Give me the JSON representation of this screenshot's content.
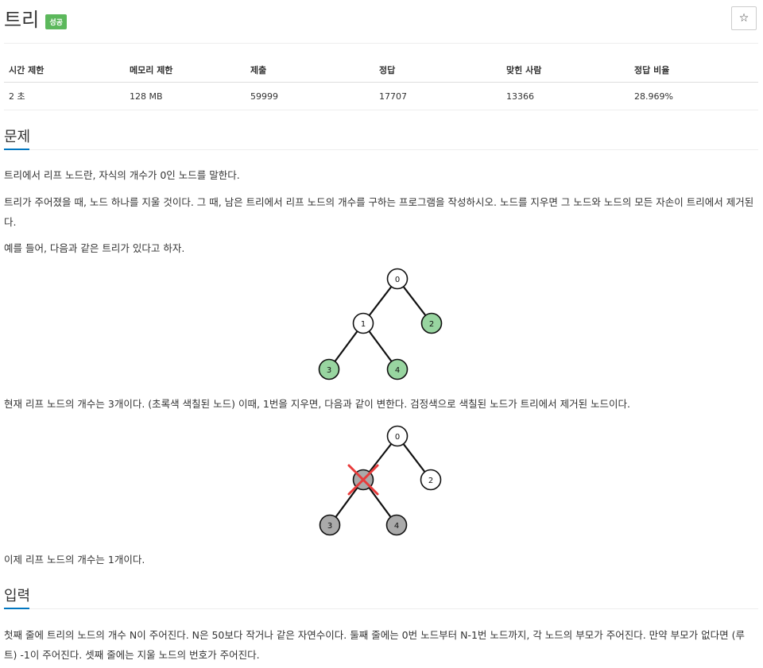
{
  "header": {
    "title": "트리",
    "status_badge": "성공",
    "star_icon": "☆"
  },
  "stats": {
    "headers": [
      "시간 제한",
      "메모리 제한",
      "제출",
      "정답",
      "맞힌 사람",
      "정답 비율"
    ],
    "values": [
      "2 초",
      "128 MB",
      "59999",
      "17707",
      "13366",
      "28.969%"
    ]
  },
  "problem": {
    "heading": "문제",
    "p1": "트리에서 리프 노드란, 자식의 개수가 0인 노드를 말한다.",
    "p2": "트리가 주어졌을 때, 노드 하나를 지울 것이다. 그 때, 남은 트리에서 리프 노드의 개수를 구하는 프로그램을 작성하시오. 노드를 지우면 그 노드와 노드의 모든 자손이 트리에서 제거된다.",
    "p3": "예를 들어, 다음과 같은 트리가 있다고 하자.",
    "p4": "현재 리프 노드의 개수는 3개이다. (초록색 색칠된 노드) 이때, 1번을 지우면, 다음과 같이 변한다. 검정색으로 색칠된 노드가 트리에서 제거된 노드이다.",
    "p5": "이제 리프 노드의 개수는 1개이다."
  },
  "tree1": {
    "nodes": [
      "0",
      "1",
      "2",
      "3",
      "4"
    ],
    "colors": {
      "leaf": "#98d5a0",
      "normal": "#ffffff"
    }
  },
  "tree2": {
    "nodes": [
      "0",
      "1",
      "2",
      "3",
      "4"
    ],
    "colors": {
      "removed": "#aaaaaa",
      "normal": "#ffffff",
      "cross": "#e83b3b"
    }
  },
  "input": {
    "heading": "입력",
    "p1": "첫째 줄에 트리의 노드의 개수 N이 주어진다. N은 50보다 작거나 같은 자연수이다. 둘째 줄에는 0번 노드부터 N-1번 노드까지, 각 노드의 부모가 주어진다. 만약 부모가 없다면 (루트) -1이 주어진다. 셋째 줄에는 지울 노드의 번호가 주어진다."
  }
}
